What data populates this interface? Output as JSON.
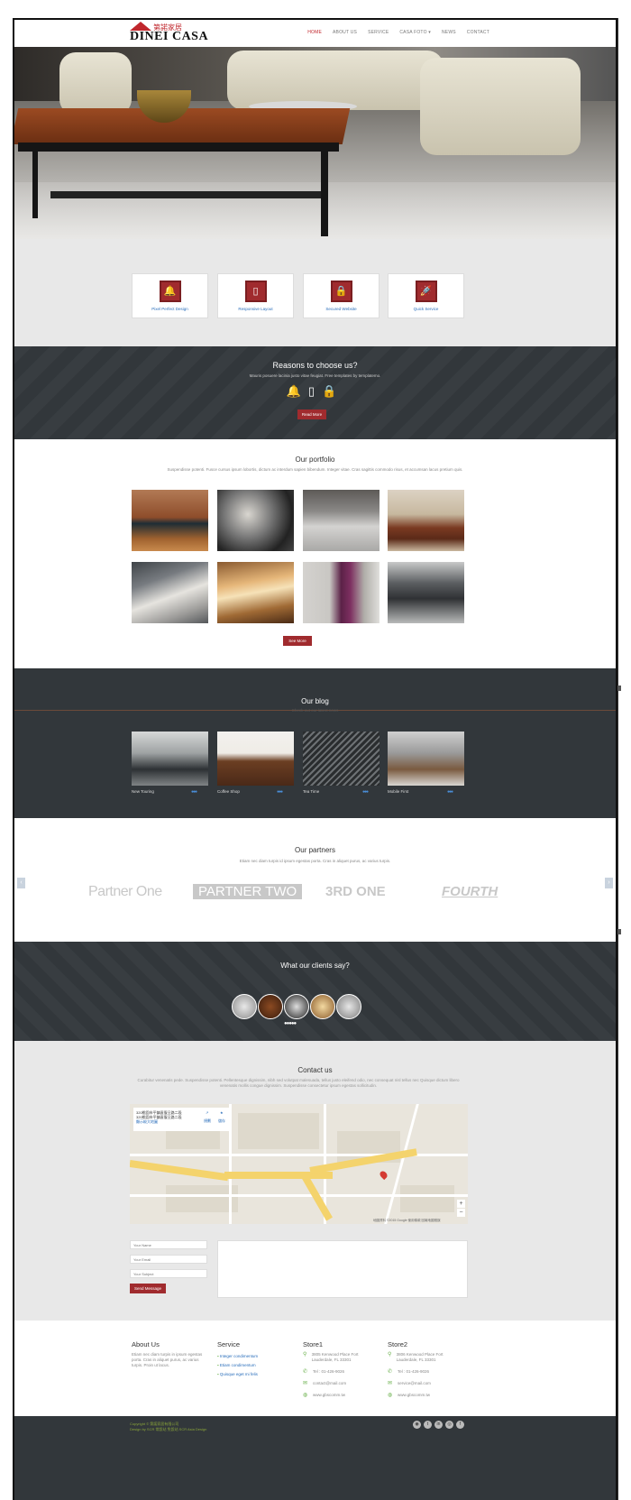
{
  "brand": {
    "cn": "第諾家居",
    "en": "DINEI CASA"
  },
  "nav": {
    "items": [
      "HOME",
      "ABOUT US",
      "SERVICE",
      "CASA FOTO ▾",
      "NEWS",
      "CONTACT"
    ]
  },
  "features": [
    {
      "icon": "bell-icon",
      "glyph": "🔔",
      "label": "Pixel Perfect Design"
    },
    {
      "icon": "tablet-icon",
      "glyph": "▯",
      "label": "Responsive Layout"
    },
    {
      "icon": "lock-icon",
      "glyph": "🔒",
      "label": "Secured Website"
    },
    {
      "icon": "rocket-icon",
      "glyph": "🚀",
      "label": "Quick Service"
    }
  ],
  "reasons": {
    "title": "Reasons to choose us?",
    "text": "Mauris posuere lacinia justo vitae feugiat. Free templates by templatemo.",
    "button": "Read More"
  },
  "portfolio": {
    "title": "Our portfolio",
    "subtitle": "Suspendisse potenti. Fusce cursus ipsum lobortis, dictum ac interdum sapien bibendum. Integer vitae. Cras sagittis commodo risus, et accumsan lacus pretium quis.",
    "button": "See More"
  },
  "blog": {
    "title": "Our blog",
    "subtitle": "Check out our latest news",
    "posts": [
      {
        "caption": "New Touring",
        "dots": "●●●"
      },
      {
        "caption": "Coffee Shop",
        "dots": "●●●"
      },
      {
        "caption": "Tea Time",
        "dots": "●●●"
      },
      {
        "caption": "Mobile First",
        "dots": "●●●"
      }
    ]
  },
  "partners": {
    "title": "Our partners",
    "subtitle": "Etiam nec diam turpis id ipsum egestas porta. Cras in aliquet purus, ac varius turpis.",
    "logos": [
      "Partner One",
      "PARTNER TWO",
      "3RD ONE",
      "FOURTH"
    ],
    "prev": "‹",
    "next": "›"
  },
  "clients": {
    "title": "What our clients say?",
    "dots": "●●●●●"
  },
  "contact": {
    "title": "Contact us",
    "subtitle": "Curabitur venenatis pede. Suspendisse potenti. Pellentesque dignissim, nibh sed volutpat malesuada, tellus justo eleifend odio, nec consequat nisl tellus nec Quisque dictum libero venenatis mollis congue dignissim. Suspendisse consectetur ipsum egestas sollicitudin.",
    "map": {
      "place": "320桃園市平鎮區復旦路二段",
      "address": "320桃園市平鎮區復旦路二段",
      "link": "顯示較大地圖",
      "directions": "規劃",
      "save": "儲存",
      "footer": "地圖資料 ©2015 Google  使用條款  回報地圖錯誤",
      "zoom_in": "+",
      "zoom_out": "−"
    },
    "name_placeholder": "Your Name",
    "email_placeholder": "Your Email",
    "subject_placeholder": "Your Subject",
    "send": "Send Message"
  },
  "footer": {
    "about": {
      "title": "About Us",
      "text": "Etiam nec diam turpis in ipsum egestas porta. Cras in aliquet purus, ac varius turpis. Proin ut lacus."
    },
    "service": {
      "title": "Service",
      "items": [
        "Integer condimentum",
        "Etiam condimentum",
        "Quisque eget mi felis"
      ]
    },
    "store1": {
      "title": "Store1",
      "address": "3805 Kenwood Place Fort Lauderdale, FL 33301",
      "phone": "Tel : 01-426-9026",
      "email": "contact@mail.com",
      "web": "www.gbscomm.tw"
    },
    "store2": {
      "title": "Store2",
      "address": "3806 Kenwood Place Fort Lauderdale, FL 33301",
      "phone": "Tel : 01-426-9026",
      "email": "service@mail.com",
      "web": "www.gbscomm.tw"
    }
  },
  "bottom": {
    "copyright": "Copyright © 第諾家居有限公司",
    "design": "Design by SCR  常設站  免設站  SCR Asia Design",
    "social": [
      "rss-icon",
      "twitter-icon",
      "linkedin-icon",
      "dribbble-icon",
      "facebook-icon"
    ]
  },
  "colors": {
    "accent": "#a02b2e",
    "dark": "#32373b",
    "link": "#2a6ebb",
    "green": "#6ab04c"
  }
}
